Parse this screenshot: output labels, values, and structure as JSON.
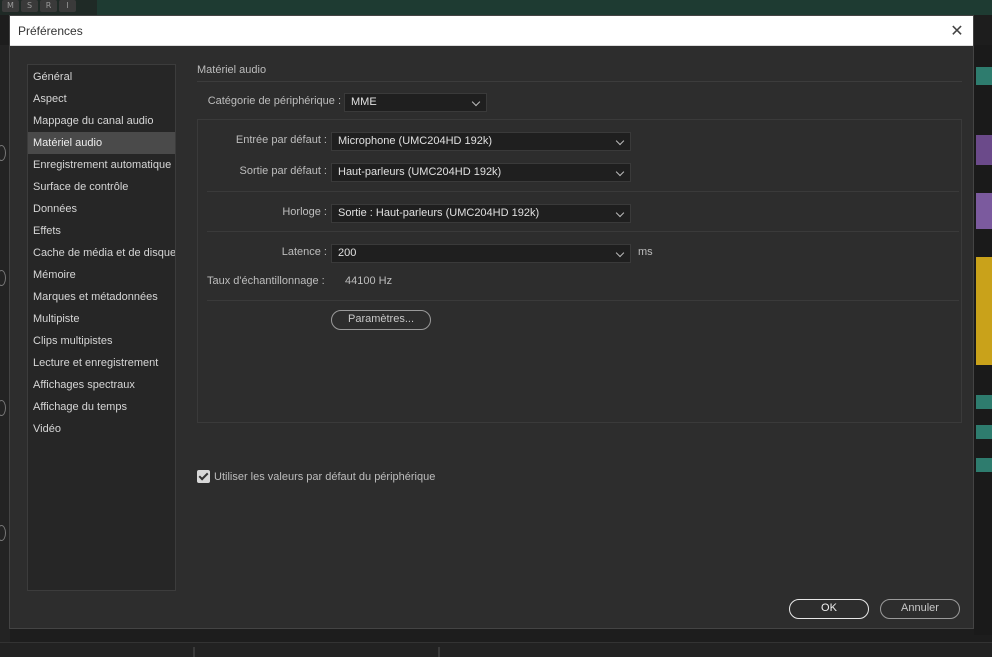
{
  "dialog": {
    "title": "Préférences",
    "close_icon": "close-icon"
  },
  "sidebar": {
    "items": [
      {
        "label": "Général"
      },
      {
        "label": "Aspect"
      },
      {
        "label": "Mappage du canal audio"
      },
      {
        "label": "Matériel audio",
        "selected": true
      },
      {
        "label": "Enregistrement automatique"
      },
      {
        "label": "Surface de contrôle"
      },
      {
        "label": "Données"
      },
      {
        "label": "Effets"
      },
      {
        "label": "Cache de média et de disque"
      },
      {
        "label": "Mémoire"
      },
      {
        "label": "Marques et métadonnées"
      },
      {
        "label": "Multipiste"
      },
      {
        "label": "Clips multipistes"
      },
      {
        "label": "Lecture et enregistrement"
      },
      {
        "label": "Affichages spectraux"
      },
      {
        "label": "Affichage du temps"
      },
      {
        "label": "Vidéo"
      }
    ]
  },
  "panel": {
    "title": "Matériel audio",
    "device_category": {
      "label": "Catégorie de périphérique :",
      "value": "MME"
    },
    "default_input": {
      "label": "Entrée par défaut :",
      "value": "Microphone (UMC204HD 192k)"
    },
    "default_output": {
      "label": "Sortie par défaut :",
      "value": "Haut-parleurs (UMC204HD 192k)"
    },
    "clock": {
      "label": "Horloge :",
      "value": "Sortie : Haut-parleurs (UMC204HD 192k)"
    },
    "latency": {
      "label": "Latence :",
      "value": "200",
      "unit": "ms"
    },
    "sample_rate": {
      "label": "Taux d'échantillonnage :",
      "value": "44100 Hz"
    },
    "settings_button": "Paramètres...",
    "use_defaults": {
      "label": "Utiliser les valeurs par défaut du périphérique",
      "checked": true
    }
  },
  "footer": {
    "ok_label": "OK",
    "cancel_label": "Annuler"
  },
  "background": {
    "track_buttons": [
      "M",
      "S",
      "R",
      "I"
    ]
  }
}
